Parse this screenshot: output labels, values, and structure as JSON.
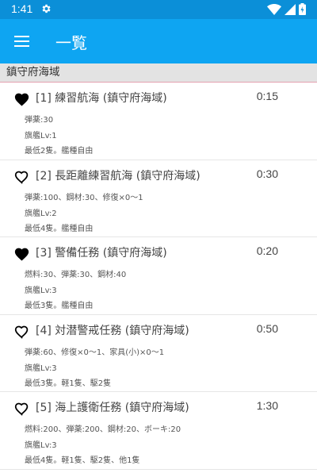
{
  "status_bar": {
    "time": "1:41",
    "icons": [
      "gear-icon",
      "wifi-icon",
      "signal-icon",
      "battery-icon"
    ]
  },
  "app_bar": {
    "title": "一覧",
    "menu_icon": "menu-icon"
  },
  "section": {
    "title": "鎮守府海域"
  },
  "colors": {
    "status_bar": "#0b8fd8",
    "app_bar": "#0ea5f2",
    "section_bg": "#e3e3e3",
    "section_divider": "#e4a0b0"
  },
  "expeditions": [
    {
      "title": "[1] 練習航海 (鎮守府海域)",
      "time": "0:15",
      "favorite": true,
      "resources": "弾薬:30",
      "flagship": "旗艦Lv:1",
      "fleet": "最低2隻。艦種自由"
    },
    {
      "title": "[2] 長距離練習航海 (鎮守府海域)",
      "time": "0:30",
      "favorite": false,
      "resources": "弾薬:100、鋼材:30、修復×0〜1",
      "flagship": "旗艦Lv:2",
      "fleet": "最低4隻。艦種自由"
    },
    {
      "title": "[3] 警備任務 (鎮守府海域)",
      "time": "0:20",
      "favorite": true,
      "resources": "燃料:30、弾薬:30、鋼材:40",
      "flagship": "旗艦Lv:3",
      "fleet": "最低3隻。艦種自由"
    },
    {
      "title": "[4] 対潜警戒任務 (鎮守府海域)",
      "time": "0:50",
      "favorite": false,
      "resources": "弾薬:60、修復×0〜1、家具(小)×0〜1",
      "flagship": "旗艦Lv:3",
      "fleet": "最低3隻。軽1隻、駆2隻"
    },
    {
      "title": "[5] 海上護衛任務 (鎮守府海域)",
      "time": "1:30",
      "favorite": false,
      "resources": "燃料:200、弾薬:200、鋼材:20、ボーキ:20",
      "flagship": "旗艦Lv:3",
      "fleet": "最低4隻。軽1隻、駆2隻、他1隻"
    }
  ]
}
